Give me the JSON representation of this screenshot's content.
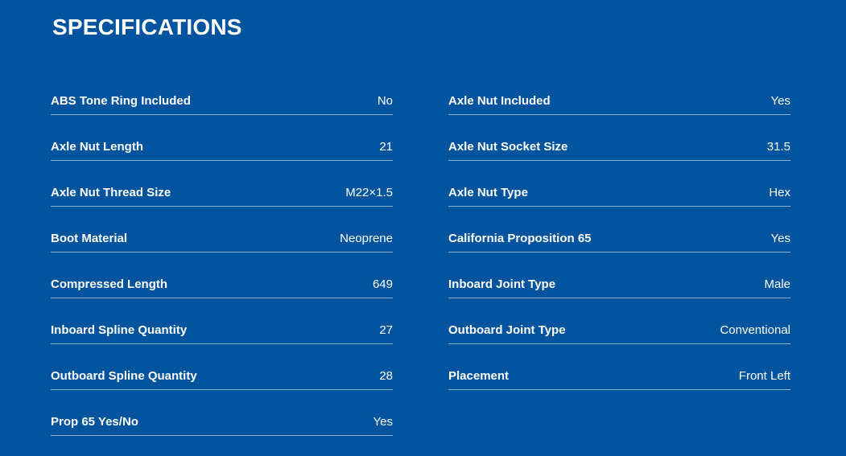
{
  "section": {
    "title": "SPECIFICATIONS"
  },
  "specs": {
    "left": [
      {
        "label": "ABS Tone Ring Included",
        "value": "No"
      },
      {
        "label": "Axle Nut Length",
        "value": "21"
      },
      {
        "label": "Axle Nut Thread Size",
        "value": "M22×1.5"
      },
      {
        "label": "Boot Material",
        "value": "Neoprene"
      },
      {
        "label": "Compressed Length",
        "value": "649"
      },
      {
        "label": "Inboard Spline Quantity",
        "value": "27"
      },
      {
        "label": "Outboard Spline Quantity",
        "value": "28"
      },
      {
        "label": "Prop 65 Yes/No",
        "value": "Yes"
      }
    ],
    "right": [
      {
        "label": "Axle Nut Included",
        "value": "Yes"
      },
      {
        "label": "Axle Nut Socket Size",
        "value": "31.5"
      },
      {
        "label": "Axle Nut Type",
        "value": "Hex"
      },
      {
        "label": "California Proposition 65",
        "value": "Yes"
      },
      {
        "label": "Inboard Joint Type",
        "value": "Male"
      },
      {
        "label": "Outboard Joint Type",
        "value": "Conventional"
      },
      {
        "label": "Placement",
        "value": "Front Left"
      }
    ]
  },
  "colors": {
    "background": "#02549f",
    "text": "#ffffff"
  }
}
